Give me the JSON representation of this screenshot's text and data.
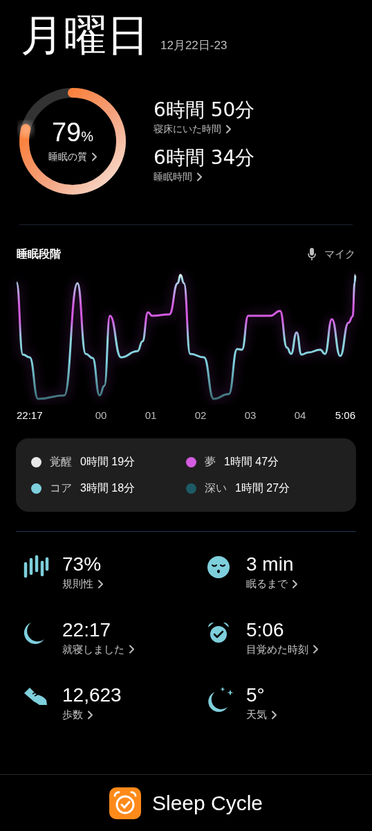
{
  "header": {
    "day": "月曜日",
    "date_range": "12月22日-23"
  },
  "quality": {
    "value": "79",
    "unit": "%",
    "label": "睡眠の質",
    "level": 0.79
  },
  "durations": [
    {
      "value": "6時間 50分",
      "label": "寝床にいた時間"
    },
    {
      "value": "6時間 34分",
      "label": "睡眠時間"
    }
  ],
  "stages": {
    "title": "睡眠段階",
    "mic_label": "マイク",
    "time_labels": [
      "22:17",
      "00",
      "01",
      "02",
      "03",
      "04",
      "5:06"
    ]
  },
  "legend": [
    {
      "name": "覚醒",
      "duration": "0時間 19分",
      "color": "#e8e8e8"
    },
    {
      "name": "夢",
      "duration": "1時間 47分",
      "color": "#d35ce0"
    },
    {
      "name": "コア",
      "duration": "3時間 18分",
      "color": "#7ecfdc"
    },
    {
      "name": "深い",
      "duration": "1時間 27分",
      "color": "#1e5a66"
    }
  ],
  "stats": [
    {
      "kind": "regularity",
      "value": "73%",
      "label": "規則性"
    },
    {
      "kind": "fall_asleep",
      "value": "3 min",
      "label": "眠るまで"
    },
    {
      "kind": "bedtime",
      "value": "22:17",
      "label": "就寝しました"
    },
    {
      "kind": "wake",
      "value": "5:06",
      "label": "目覚めた時刻"
    },
    {
      "kind": "steps",
      "value": "12,623",
      "label": "歩数"
    },
    {
      "kind": "weather",
      "value": "5°",
      "label": "天気"
    }
  ],
  "footer": {
    "app_name": "Sleep Cycle"
  }
}
